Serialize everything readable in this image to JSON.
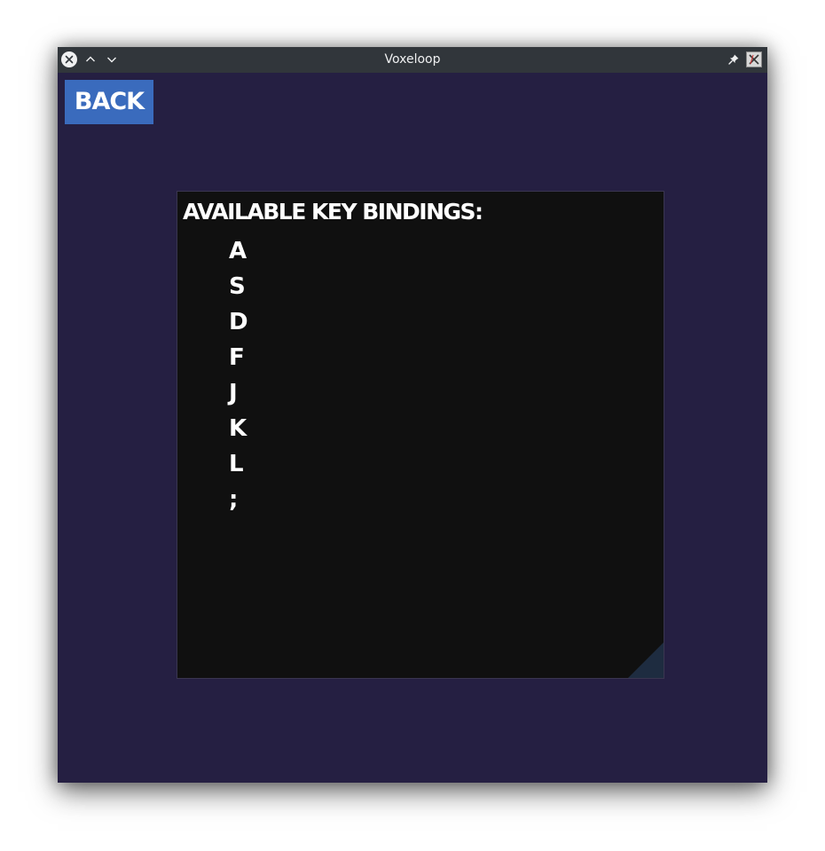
{
  "window": {
    "title": "Voxeloop"
  },
  "titlebar": {
    "close_icon": "close-icon",
    "up_icon": "chevron-up-icon",
    "down_icon": "chevron-down-icon",
    "pin_icon": "pin-icon",
    "app_icon": "app-icon"
  },
  "back_button": {
    "label": "Back"
  },
  "key_bindings": {
    "heading": "Available key bindings:",
    "keys": [
      "A",
      "S",
      "D",
      "F",
      "J",
      "K",
      "L",
      ";"
    ]
  },
  "colors": {
    "window_background": "#251f42",
    "titlebar": "#31363b",
    "button": "#3a6bbd",
    "panel_background": "#101010",
    "resize_grip": "#1e2c40",
    "text": "#ffffff"
  }
}
